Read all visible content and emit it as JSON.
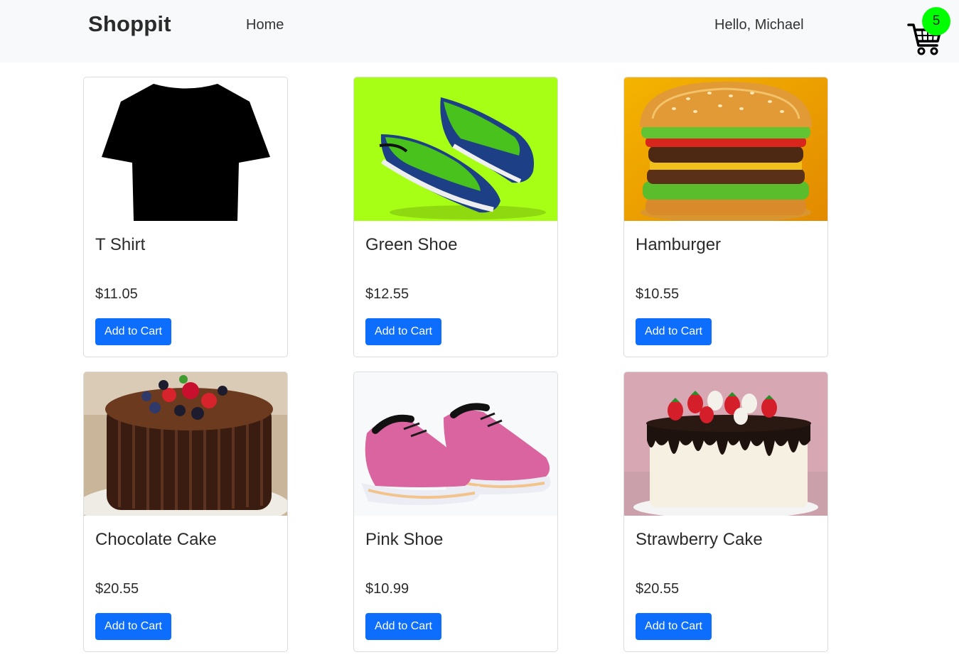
{
  "navbar": {
    "brand": "Shoppit",
    "home_link": "Home",
    "greeting": "Hello, Michael",
    "cart_count": "5",
    "cart_icon": "shopping-cart-icon",
    "badge_color": "#00ff00",
    "background": "#f8f9fa"
  },
  "accent_color": "#0d6efd",
  "products": [
    {
      "name": "T Shirt",
      "price": "$11.05",
      "button_label": "Add to Cart",
      "image": "black-tshirt-image"
    },
    {
      "name": "Green Shoe",
      "price": "$12.55",
      "button_label": "Add to Cart",
      "image": "green-shoes-image"
    },
    {
      "name": "Hamburger",
      "price": "$10.55",
      "button_label": "Add to Cart",
      "image": "hamburger-image"
    },
    {
      "name": "Chocolate Cake",
      "price": "$20.55",
      "button_label": "Add to Cart",
      "image": "chocolate-cake-image"
    },
    {
      "name": "Pink Shoe",
      "price": "$10.99",
      "button_label": "Add to Cart",
      "image": "pink-shoes-image"
    },
    {
      "name": "Strawberry Cake",
      "price": "$20.55",
      "button_label": "Add to Cart",
      "image": "strawberry-cake-image"
    }
  ]
}
